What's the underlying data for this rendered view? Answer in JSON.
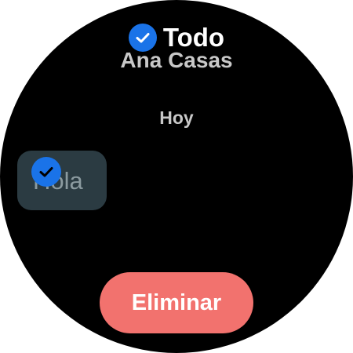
{
  "header": {
    "icon": "check-circle-icon",
    "title": "Todo"
  },
  "conversation": {
    "contact_name": "Ana Casas",
    "date_label": "Hoy",
    "messages": [
      {
        "text": "Hola",
        "selected": true,
        "selected_icon": "check-circle-icon"
      }
    ]
  },
  "actions": {
    "delete_label": "Eliminar"
  },
  "colors": {
    "background": "#000000",
    "accent_blue": "#1a73e8",
    "bubble": "#2b3b42",
    "delete_button": "#f2726e"
  }
}
